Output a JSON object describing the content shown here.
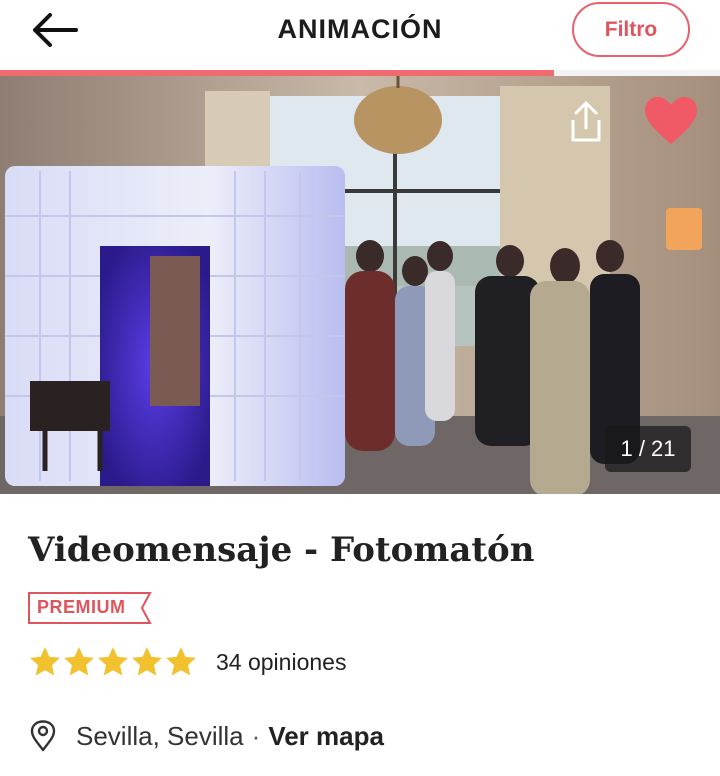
{
  "header": {
    "title": "ANIMACIÓN",
    "filter_label": "Filtro",
    "progress_percent": 77
  },
  "gallery": {
    "counter": "1 / 21",
    "icons": [
      "back-arrow-icon",
      "share-icon",
      "heart-icon"
    ]
  },
  "listing": {
    "title": "Videomensaje - Fotomatón",
    "badge": "PREMIUM",
    "rating_stars": 5,
    "reviews": "34 opiniones",
    "location": "Sevilla, Sevilla",
    "separator": "·",
    "map_link": "Ver mapa"
  },
  "colors": {
    "accent": "#e0545e",
    "heart": "#f05a66",
    "star": "#f2c12e"
  }
}
